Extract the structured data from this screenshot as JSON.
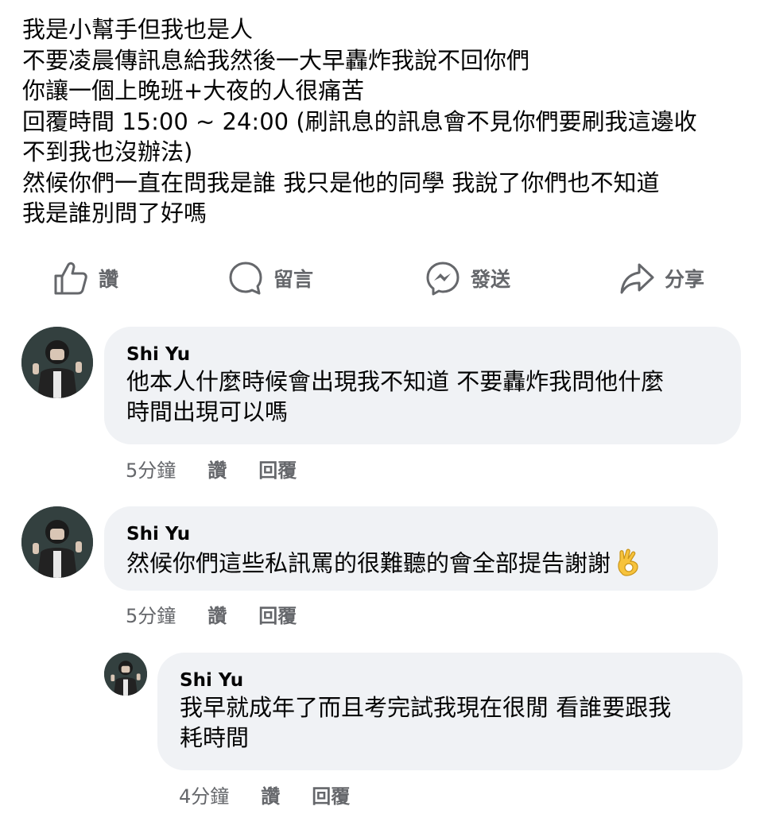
{
  "post": {
    "lines": [
      "我是小幫手但我也是人",
      "不要凌晨傳訊息給我然後一大早轟炸我說不回你們",
      "你讓一個上晚班+大夜的人很痛苦",
      "回覆時間 15:00 ~ 24:00 (刷訊息的訊息會不見你們要刷我這邊收",
      "不到我也沒辦法)",
      "然候你們一直在問我是誰 我只是他的同學 我說了你們也不知道",
      "我是誰別問了好嗎"
    ]
  },
  "actions": {
    "like_label": "讚",
    "comment_label": "留言",
    "send_label": "發送",
    "share_label": "分享"
  },
  "comments": [
    {
      "author": "Shi Yu",
      "lines": [
        "他本人什麼時候會出現我不知道 不要轟炸我問他什麼",
        "時間出現可以嗎"
      ],
      "time": "5分鐘",
      "like": "讚",
      "reply": "回覆"
    },
    {
      "author": "Shi Yu",
      "lines": [
        "然候你們這些私訊罵的很難聽的會全部提告謝謝"
      ],
      "emoji": "ok-hand-emoji",
      "time": "5分鐘",
      "like": "讚",
      "reply": "回覆"
    },
    {
      "author": "Shi Yu",
      "lines": [
        "我早就成年了而且考完試我現在很閒 看誰要跟我",
        "耗時間"
      ],
      "time": "4分鐘",
      "like": "讚",
      "reply": "回覆"
    }
  ],
  "colors": {
    "text": "#050505",
    "secondary": "#65676b",
    "bubble": "#f0f2f5"
  }
}
